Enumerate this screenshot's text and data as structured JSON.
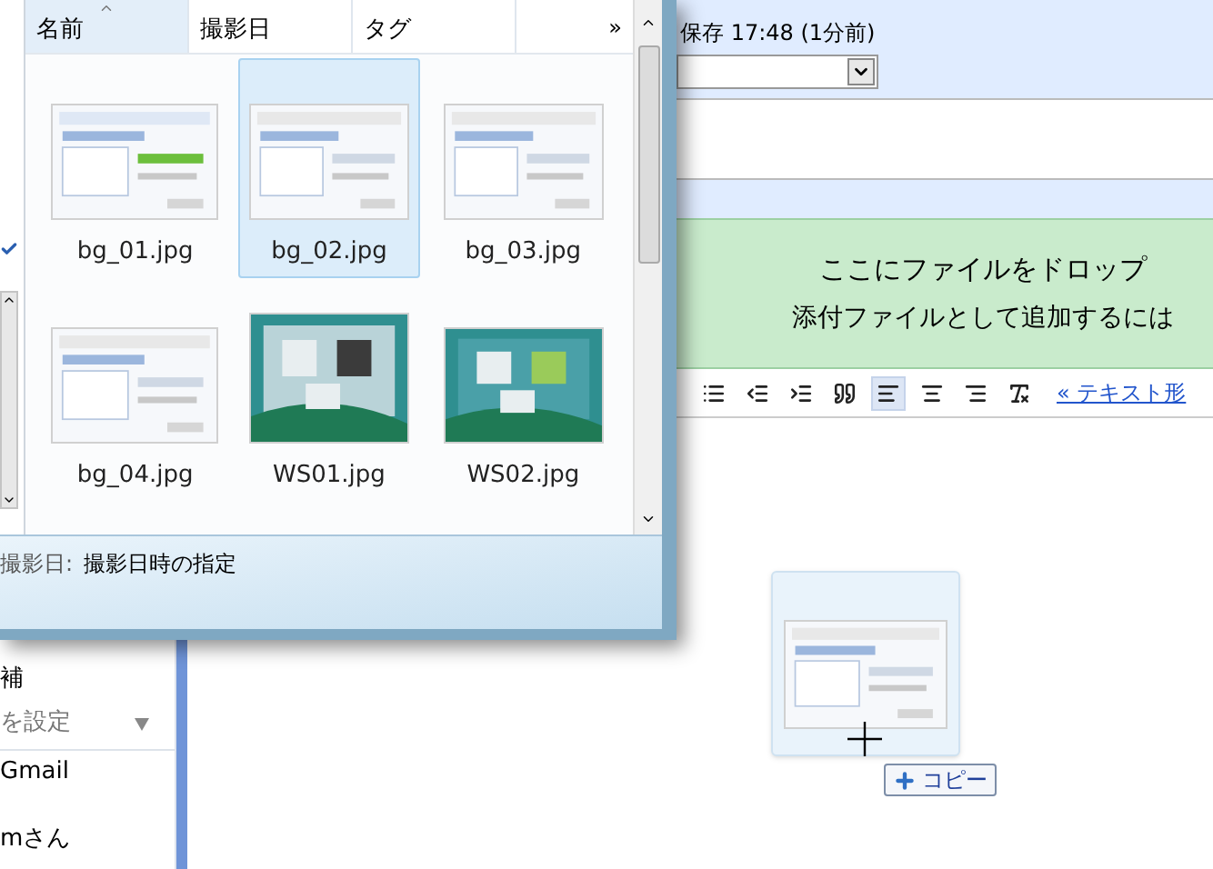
{
  "explorer": {
    "columns": [
      {
        "label": "名前",
        "sorted": true
      },
      {
        "label": "撮影日",
        "sorted": false
      },
      {
        "label": "タグ",
        "sorted": false
      }
    ],
    "more": "»",
    "files": [
      {
        "name": "bg_01.jpg",
        "selected": false
      },
      {
        "name": "bg_02.jpg",
        "selected": true
      },
      {
        "name": "bg_03.jpg",
        "selected": false
      },
      {
        "name": "bg_04.jpg",
        "selected": false
      },
      {
        "name": "WS01.jpg",
        "selected": false
      },
      {
        "name": "WS02.jpg",
        "selected": false
      }
    ],
    "details": {
      "label": "撮影日:",
      "value": "撮影日時の指定"
    }
  },
  "sidebar": {
    "items": [
      {
        "kind": "text",
        "text": "補"
      },
      {
        "kind": "dropdown",
        "text": "を設定"
      },
      {
        "kind": "text",
        "text": "Gmail"
      },
      {
        "kind": "text",
        "text": "mさん"
      }
    ]
  },
  "compose": {
    "saved": "保存 17:48 (1分前)",
    "drop_zone": {
      "title": "ここにファイルをドロップ",
      "subtitle": "添付ファイルとして追加するには"
    },
    "toolbar": [
      {
        "kind": "bulleted-list",
        "selected": false
      },
      {
        "kind": "indent-less",
        "selected": false
      },
      {
        "kind": "indent-more",
        "selected": false
      },
      {
        "kind": "quote",
        "selected": false
      },
      {
        "kind": "align-left",
        "selected": true
      },
      {
        "kind": "align-center",
        "selected": false
      },
      {
        "kind": "align-right",
        "selected": false
      },
      {
        "kind": "remove-formatting",
        "selected": false
      }
    ],
    "plain_text_link": "« テキスト形"
  },
  "drag": {
    "badge": "コピー"
  }
}
